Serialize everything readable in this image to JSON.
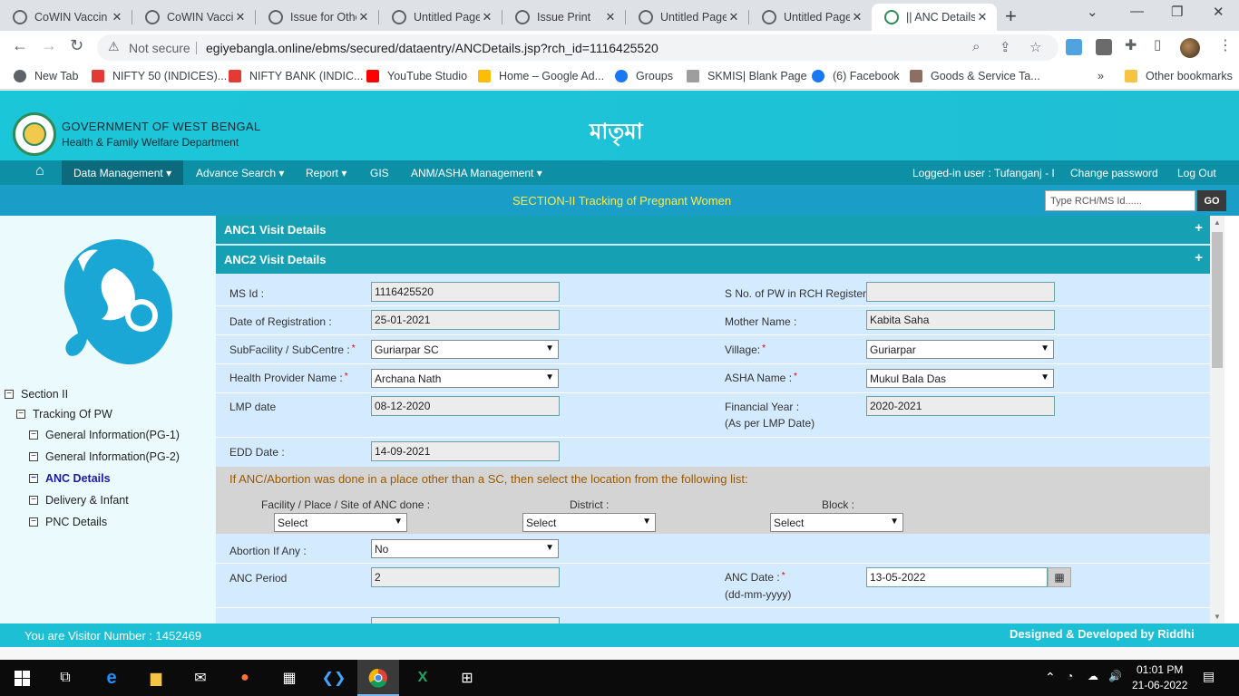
{
  "browser": {
    "tabs": [
      {
        "title": "CoWIN Vaccin"
      },
      {
        "title": "CoWIN Vaccin"
      },
      {
        "title": "Issue for Othe"
      },
      {
        "title": "Untitled Page"
      },
      {
        "title": "Issue Print"
      },
      {
        "title": "Untitled Page"
      },
      {
        "title": "Untitled Page"
      },
      {
        "title": "|| ANC Details"
      }
    ],
    "not_secure": "Not secure",
    "url": "egiyebangla.online/ebms/secured/dataentry/ANCDetails.jsp?rch_id=1116425520",
    "bookmarks": [
      {
        "label": "New Tab",
        "color": "#5f6368"
      },
      {
        "label": "NIFTY 50 (INDICES)...",
        "color": "#e53935"
      },
      {
        "label": "NIFTY BANK (INDIC...",
        "color": "#e53935"
      },
      {
        "label": "YouTube Studio",
        "color": "#ff0000"
      },
      {
        "label": "Home – Google Ad...",
        "color": "#fbbc04"
      },
      {
        "label": "Groups",
        "color": "#1877f2"
      },
      {
        "label": "SKMIS| Blank Page",
        "color": "#9e9e9e"
      },
      {
        "label": "(6) Facebook",
        "color": "#1877f2"
      },
      {
        "label": "Goods & Service Ta...",
        "color": "#8d6e63"
      }
    ],
    "more_bookmarks": "»",
    "other_bookmarks": "Other bookmarks"
  },
  "header": {
    "gov_title": "GOVERNMENT OF WEST BENGAL",
    "dept_title": "Health & Family Welfare Department",
    "brand": "মাতৃমা"
  },
  "nav": {
    "items": [
      "Data Management",
      "Advance Search",
      "Report",
      "GIS",
      "ANM/ASHA Management"
    ],
    "logged_in": "Logged-in user : Tufanganj - I",
    "change_password": "Change password",
    "logout": "Log Out"
  },
  "section": {
    "title": "SECTION-II Tracking of Pregnant Women",
    "search_placeholder": "Type RCH/MS Id......",
    "go": "GO"
  },
  "tree": {
    "root": "Section II",
    "child": "Tracking Of PW",
    "items": [
      "General Information(PG-1)",
      "General Information(PG-2)",
      "ANC Details",
      "Delivery & Infant",
      "PNC Details"
    ]
  },
  "form": {
    "anc1_title": "ANC1 Visit Details",
    "anc2_title": "ANC2 Visit Details",
    "expand": "+",
    "ms_id_label": "MS Id :",
    "ms_id": "1116425520",
    "sno_label": "S No. of PW in RCH Register :",
    "sno": "",
    "reg_date_label": "Date of Registration :",
    "reg_date": "25-01-2021",
    "mother_label": "Mother Name :",
    "mother": "Kabita Saha",
    "subfacility_label": "SubFacility / SubCentre :",
    "subfacility": "Guriarpar SC",
    "village_label": "Village:",
    "village": "Guriarpar",
    "provider_label": "Health Provider Name :",
    "provider": "Archana Nath",
    "asha_label": "ASHA Name :",
    "asha": "Mukul Bala Das",
    "lmp_label": "LMP date",
    "lmp": "08-12-2020",
    "fy_label": "Financial Year :",
    "fy_sub": "(As per LMP Date)",
    "fy": "2020-2021",
    "edd_label": "EDD Date :",
    "edd": "14-09-2021",
    "other_loc_msg": "If ANC/Abortion was done in a place other than a SC, then select the location from the following list:",
    "facility_label": "Facility / Place / Site of ANC done :",
    "district_label": "District :",
    "block_label": "Block :",
    "select": "Select",
    "abortion_label": "Abortion If Any :",
    "abortion": "No",
    "anc_period_label": "ANC Period",
    "anc_period": "2",
    "anc_date_label": "ANC Date :",
    "anc_date_fmt": "(dd-mm-yyyy)",
    "anc_date": "13-05-2022",
    "required_mark": "*"
  },
  "footer": {
    "visitor": "You are Visitor Number : 1452469",
    "credit": "Designed & Developed by Riddhi"
  },
  "taskbar": {
    "time": "01:01 PM",
    "date": "21-06-2022"
  },
  "colors": {
    "header": "#1cc6d9",
    "nav": "#0d8fa6",
    "section": "#1a9ec8",
    "accordion": "#16a0b3",
    "form_bg": "#d4eaff"
  }
}
